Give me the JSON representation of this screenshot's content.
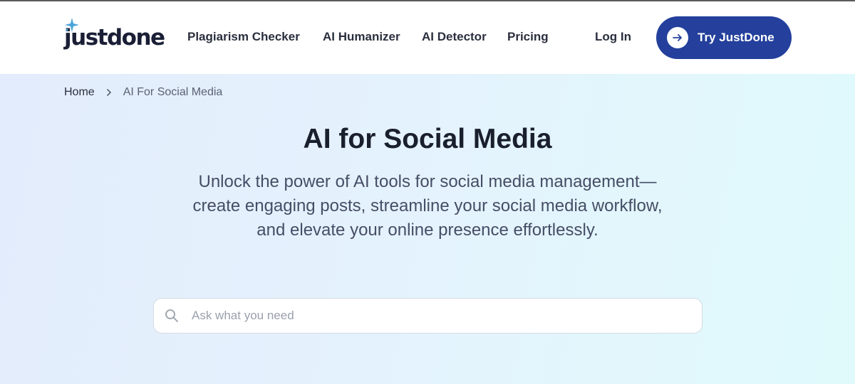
{
  "brand": {
    "name": "justdone",
    "accent": "#24409c",
    "spark_color": "#4aa3d8"
  },
  "nav": {
    "items": [
      {
        "label": "Plagiarism Checker"
      },
      {
        "label": "AI Humanizer"
      },
      {
        "label": "AI Detector"
      },
      {
        "label": "Pricing"
      }
    ],
    "login_label": "Log In",
    "cta_label": "Try JustDone",
    "cta_icon": "arrow-right-icon"
  },
  "breadcrumb": {
    "home": "Home",
    "separator_icon": "chevron-right-icon",
    "current": "AI For Social Media"
  },
  "hero": {
    "title": "AI for Social Media",
    "subtitle": "Unlock the power of AI tools for social media management—create engaging posts, streamline your social media workflow, and elevate your online presence effortlessly."
  },
  "search": {
    "placeholder": "Ask what you need",
    "value": "",
    "icon": "search-icon"
  }
}
